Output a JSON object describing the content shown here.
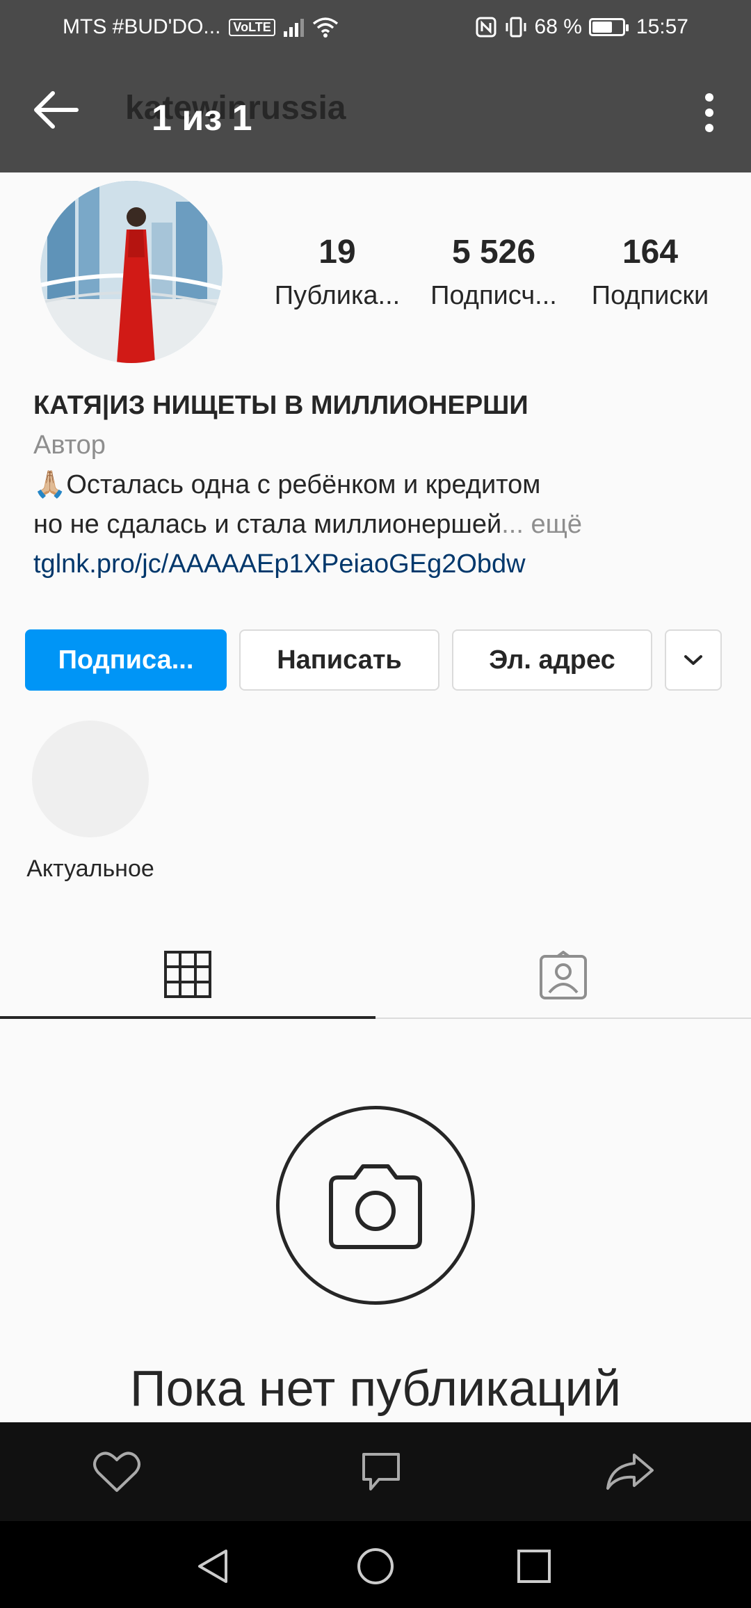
{
  "status_bar": {
    "carrier": "MTS #BUD'DO...",
    "volte": "VoLTE",
    "battery_percent": "68 %",
    "battery_level": 0.68,
    "time": "15:57"
  },
  "header": {
    "username": "katewinrussia",
    "counter": "1 из 1"
  },
  "profile": {
    "stats": [
      {
        "value": "19",
        "label": "Публика..."
      },
      {
        "value": "5 526",
        "label": "Подписч..."
      },
      {
        "value": "164",
        "label": "Подписки"
      }
    ],
    "name": "КАТЯ|ИЗ НИЩЕТЫ В МИЛЛИОНЕРШИ",
    "category": "Автор",
    "bio_line1": "🙏🏼Осталась одна с ребёнком и кредитом",
    "bio_line2": "но не сдалась и стала миллионершей",
    "bio_more": "... ещё",
    "link": "tglnk.pro/jc/AAAAAEp1XPeiaoGEg2Obdw"
  },
  "actions": {
    "subscribe": "Подписа...",
    "message": "Написать",
    "email": "Эл. адрес"
  },
  "highlights": [
    {
      "label": "Актуальное"
    }
  ],
  "empty_state": {
    "title": "Пока нет публикаций"
  },
  "colors": {
    "primary_button": "#0095f6",
    "link": "#00376b",
    "overlay": "#4a4a4a"
  },
  "icons": {
    "back": "arrow-left-icon",
    "more": "more-vertical-icon",
    "grid": "grid-icon",
    "tagged": "tagged-person-icon",
    "camera": "camera-icon",
    "like": "heart-icon",
    "comment": "comment-icon",
    "share": "share-icon"
  }
}
